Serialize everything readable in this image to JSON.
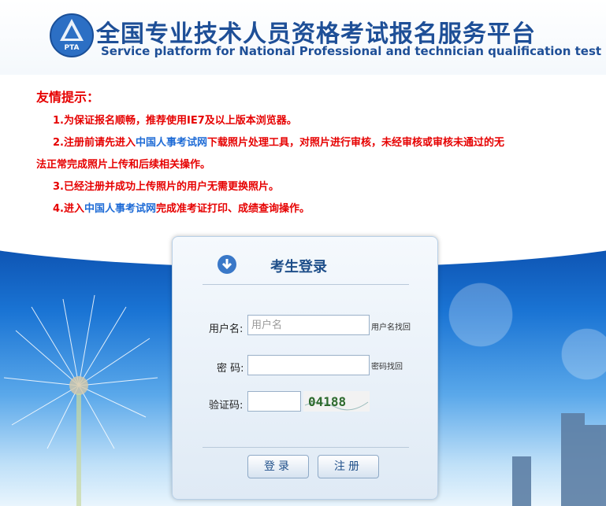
{
  "header": {
    "logo_text": "PTA",
    "title_cn": "全国专业技术人员资格考试报名服务平台",
    "title_en": "Service platform for National Professional and technician qualification test"
  },
  "notice": {
    "title": "友情提示：",
    "items": [
      {
        "pre": "1.为保证报名顺畅，推荐使用IE7及以上版本浏览器。",
        "link": "",
        "post": ""
      },
      {
        "pre": "2.注册前请先进入",
        "link": "中国人事考试网",
        "post": "下载照片处理工具，对照片进行审核，未经审核或审核未通过的无"
      },
      {
        "pre": "法正常完成照片上传和后续相关操作。",
        "link": "",
        "post": ""
      },
      {
        "pre": "3.已经注册并成功上传照片的用户无需更换照片。",
        "link": "",
        "post": ""
      },
      {
        "pre": "4.进入",
        "link": "中国人事考试网",
        "post": "完成准考证打印、成绩查询操作。"
      }
    ]
  },
  "login": {
    "title": "考生登录",
    "username_label": "用户名:",
    "username_placeholder": "用户名",
    "username_value": "",
    "username_help": "用户名找回",
    "password_label": "密 码:",
    "password_value": "",
    "password_help": "密码找回",
    "captcha_label": "验证码:",
    "captcha_value": "",
    "captcha_image_text": "04188",
    "login_button": "登录",
    "register_button": "注册"
  },
  "colors": {
    "accent": "#1e4f97",
    "notice_red": "#e60000",
    "link_blue": "#1e6bd6"
  }
}
